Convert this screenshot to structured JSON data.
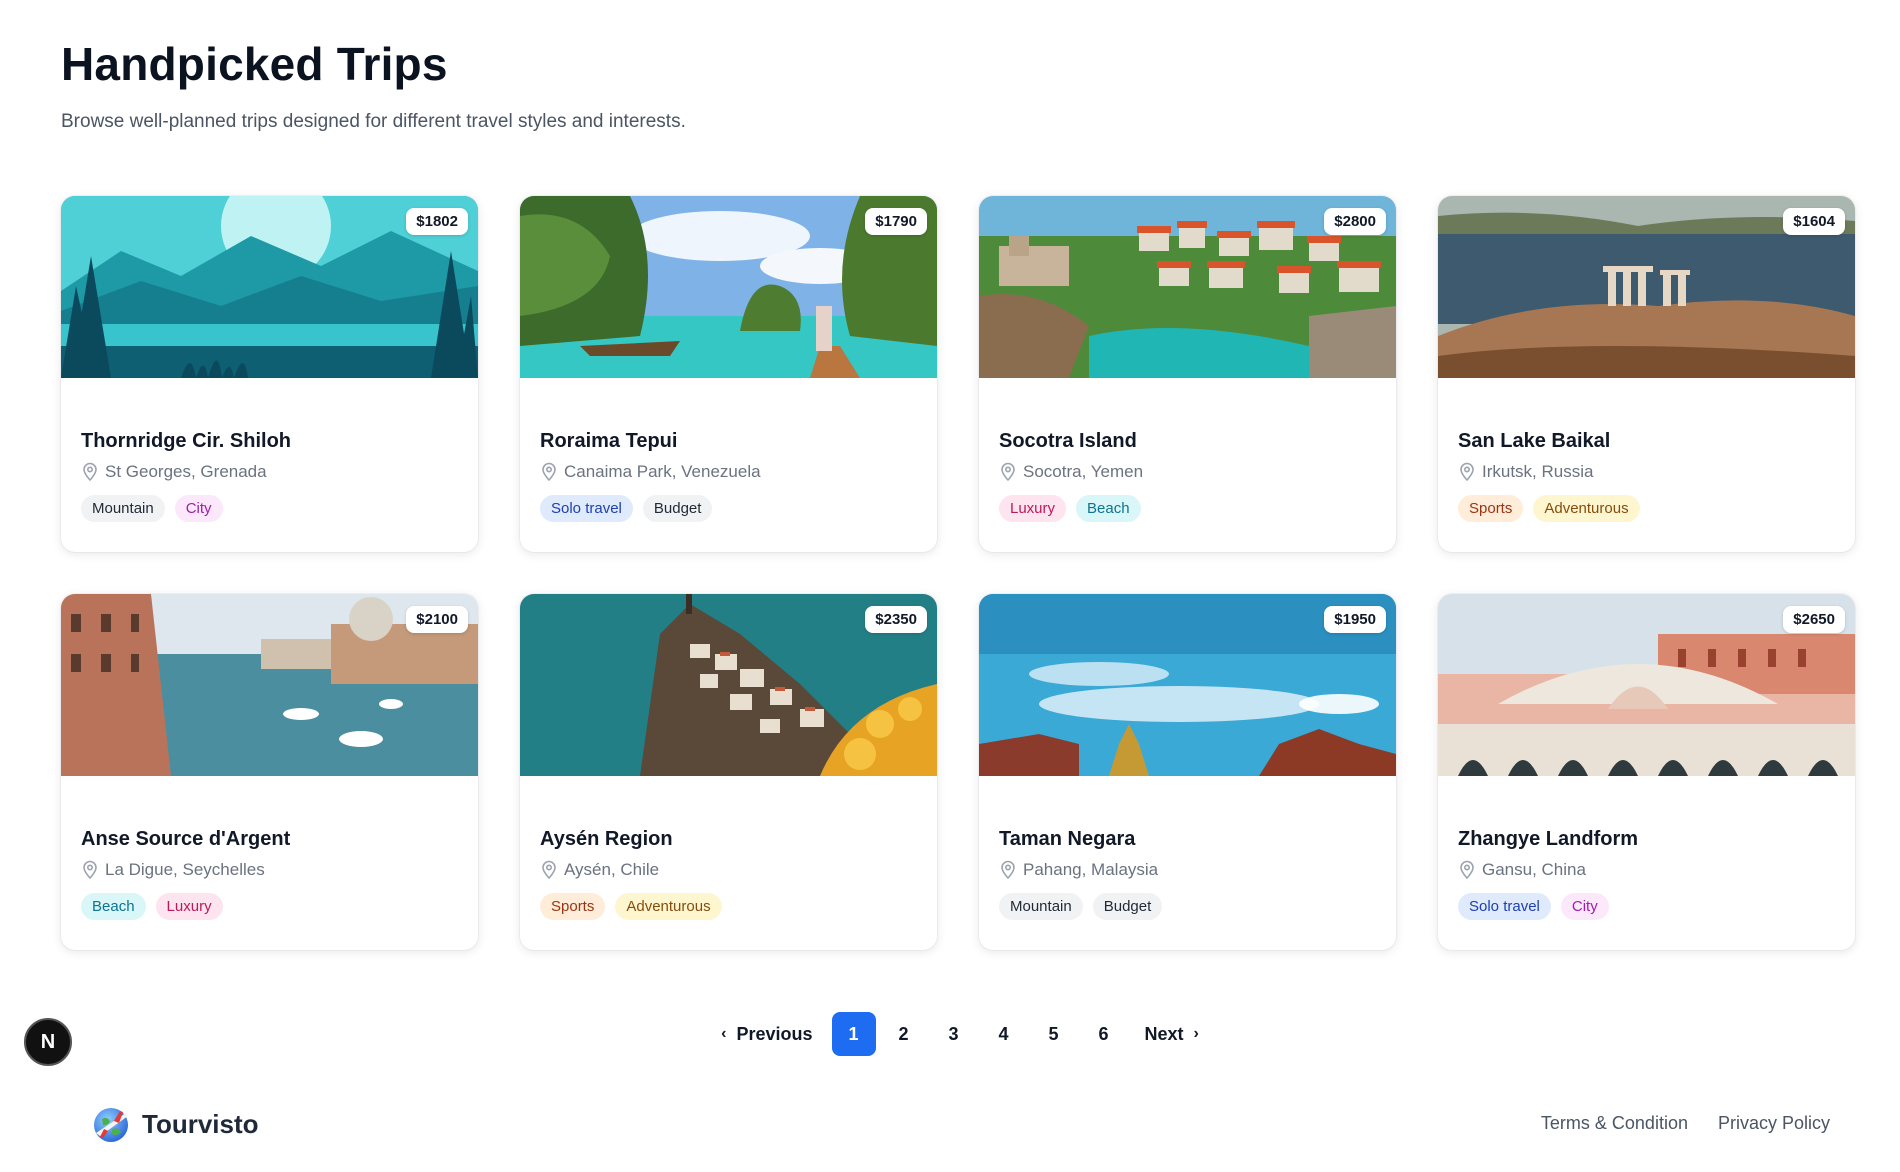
{
  "header": {
    "title": "Handpicked Trips",
    "subtitle": "Browse well-planned trips designed for different travel styles and interests."
  },
  "trips": [
    {
      "price": "$1802",
      "name": "Thornridge Cir. Shiloh",
      "location": "St Georges, Grenada",
      "tags": [
        "Mountain",
        "City"
      ],
      "image": "mountain-lake-illustration"
    },
    {
      "price": "$1790",
      "name": "Roraima Tepui",
      "location": "Canaima Park, Venezuela",
      "tags": [
        "Solo travel",
        "Budget"
      ],
      "image": "tropical-cliffs-boat"
    },
    {
      "price": "$2800",
      "name": "Socotra Island",
      "location": "Socotra, Yemen",
      "tags": [
        "Luxury",
        "Beach"
      ],
      "image": "coastal-town"
    },
    {
      "price": "$1604",
      "name": "San Lake Baikal",
      "location": "Irkutsk, Russia",
      "tags": [
        "Sports",
        "Adventurous"
      ],
      "image": "temple-ruins-sea"
    },
    {
      "price": "$2100",
      "name": "Anse Source d'Argent",
      "location": "La Digue, Seychelles",
      "tags": [
        "Beach",
        "Luxury"
      ],
      "image": "venice-canal"
    },
    {
      "price": "$2350",
      "name": "Aysén Region",
      "location": "Aysén, Chile",
      "tags": [
        "Sports",
        "Adventurous"
      ],
      "image": "cliff-village"
    },
    {
      "price": "$1950",
      "name": "Taman Negara",
      "location": "Pahang, Malaysia",
      "tags": [
        "Mountain",
        "Budget"
      ],
      "image": "sky-temple-roofs"
    },
    {
      "price": "$2650",
      "name": "Zhangye Landform",
      "location": "Gansu, China",
      "tags": [
        "Solo travel",
        "City"
      ],
      "image": "rialto-bridge"
    }
  ],
  "tag_colors": {
    "Mountain": {
      "bg": "#f1f2f4",
      "fg": "#1f2937"
    },
    "City": {
      "bg": "#fbe8fb",
      "fg": "#a21caf"
    },
    "Solo travel": {
      "bg": "#dfeafd",
      "fg": "#1e40af"
    },
    "Budget": {
      "bg": "#f1f2f4",
      "fg": "#1f2937"
    },
    "Luxury": {
      "bg": "#fde4ef",
      "fg": "#be185d"
    },
    "Beach": {
      "bg": "#d9f6f8",
      "fg": "#0e7490"
    },
    "Sports": {
      "bg": "#ffedd9",
      "fg": "#9a3412"
    },
    "Adventurous": {
      "bg": "#fef6cf",
      "fg": "#854d0e"
    }
  },
  "pagination": {
    "previous": "Previous",
    "next": "Next",
    "pages": [
      "1",
      "2",
      "3",
      "4",
      "5",
      "6"
    ],
    "current": "1"
  },
  "dev_badge": "N",
  "footer": {
    "brand": "Tourvisto",
    "links": [
      "Terms & Condition",
      "Privacy Policy"
    ]
  },
  "colors": {
    "accent": "#1d6cf2"
  }
}
